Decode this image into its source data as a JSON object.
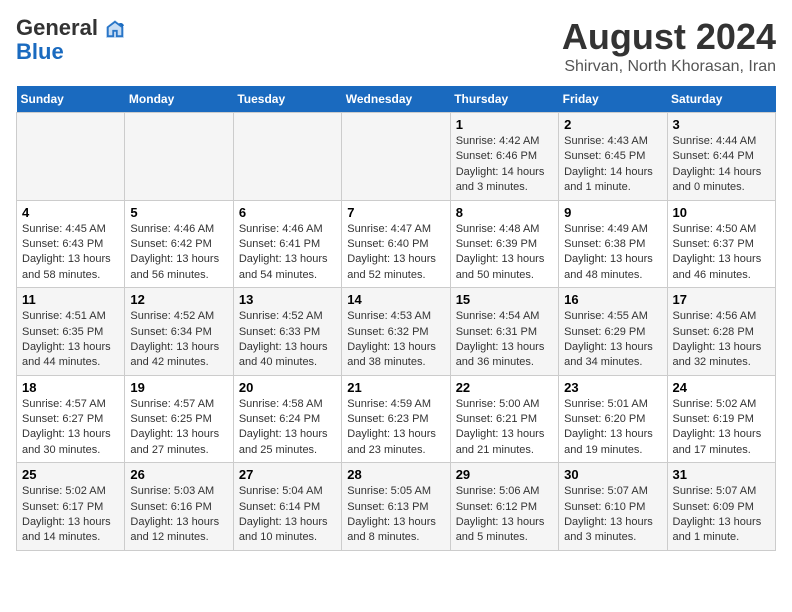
{
  "header": {
    "logo_general": "General",
    "logo_blue": "Blue",
    "main_title": "August 2024",
    "subtitle": "Shirvan, North Khorasan, Iran"
  },
  "weekdays": [
    "Sunday",
    "Monday",
    "Tuesday",
    "Wednesday",
    "Thursday",
    "Friday",
    "Saturday"
  ],
  "weeks": [
    [
      {
        "day": "",
        "info": ""
      },
      {
        "day": "",
        "info": ""
      },
      {
        "day": "",
        "info": ""
      },
      {
        "day": "",
        "info": ""
      },
      {
        "day": "1",
        "info": "Sunrise: 4:42 AM\nSunset: 6:46 PM\nDaylight: 14 hours\nand 3 minutes."
      },
      {
        "day": "2",
        "info": "Sunrise: 4:43 AM\nSunset: 6:45 PM\nDaylight: 14 hours\nand 1 minute."
      },
      {
        "day": "3",
        "info": "Sunrise: 4:44 AM\nSunset: 6:44 PM\nDaylight: 14 hours\nand 0 minutes."
      }
    ],
    [
      {
        "day": "4",
        "info": "Sunrise: 4:45 AM\nSunset: 6:43 PM\nDaylight: 13 hours\nand 58 minutes."
      },
      {
        "day": "5",
        "info": "Sunrise: 4:46 AM\nSunset: 6:42 PM\nDaylight: 13 hours\nand 56 minutes."
      },
      {
        "day": "6",
        "info": "Sunrise: 4:46 AM\nSunset: 6:41 PM\nDaylight: 13 hours\nand 54 minutes."
      },
      {
        "day": "7",
        "info": "Sunrise: 4:47 AM\nSunset: 6:40 PM\nDaylight: 13 hours\nand 52 minutes."
      },
      {
        "day": "8",
        "info": "Sunrise: 4:48 AM\nSunset: 6:39 PM\nDaylight: 13 hours\nand 50 minutes."
      },
      {
        "day": "9",
        "info": "Sunrise: 4:49 AM\nSunset: 6:38 PM\nDaylight: 13 hours\nand 48 minutes."
      },
      {
        "day": "10",
        "info": "Sunrise: 4:50 AM\nSunset: 6:37 PM\nDaylight: 13 hours\nand 46 minutes."
      }
    ],
    [
      {
        "day": "11",
        "info": "Sunrise: 4:51 AM\nSunset: 6:35 PM\nDaylight: 13 hours\nand 44 minutes."
      },
      {
        "day": "12",
        "info": "Sunrise: 4:52 AM\nSunset: 6:34 PM\nDaylight: 13 hours\nand 42 minutes."
      },
      {
        "day": "13",
        "info": "Sunrise: 4:52 AM\nSunset: 6:33 PM\nDaylight: 13 hours\nand 40 minutes."
      },
      {
        "day": "14",
        "info": "Sunrise: 4:53 AM\nSunset: 6:32 PM\nDaylight: 13 hours\nand 38 minutes."
      },
      {
        "day": "15",
        "info": "Sunrise: 4:54 AM\nSunset: 6:31 PM\nDaylight: 13 hours\nand 36 minutes."
      },
      {
        "day": "16",
        "info": "Sunrise: 4:55 AM\nSunset: 6:29 PM\nDaylight: 13 hours\nand 34 minutes."
      },
      {
        "day": "17",
        "info": "Sunrise: 4:56 AM\nSunset: 6:28 PM\nDaylight: 13 hours\nand 32 minutes."
      }
    ],
    [
      {
        "day": "18",
        "info": "Sunrise: 4:57 AM\nSunset: 6:27 PM\nDaylight: 13 hours\nand 30 minutes."
      },
      {
        "day": "19",
        "info": "Sunrise: 4:57 AM\nSunset: 6:25 PM\nDaylight: 13 hours\nand 27 minutes."
      },
      {
        "day": "20",
        "info": "Sunrise: 4:58 AM\nSunset: 6:24 PM\nDaylight: 13 hours\nand 25 minutes."
      },
      {
        "day": "21",
        "info": "Sunrise: 4:59 AM\nSunset: 6:23 PM\nDaylight: 13 hours\nand 23 minutes."
      },
      {
        "day": "22",
        "info": "Sunrise: 5:00 AM\nSunset: 6:21 PM\nDaylight: 13 hours\nand 21 minutes."
      },
      {
        "day": "23",
        "info": "Sunrise: 5:01 AM\nSunset: 6:20 PM\nDaylight: 13 hours\nand 19 minutes."
      },
      {
        "day": "24",
        "info": "Sunrise: 5:02 AM\nSunset: 6:19 PM\nDaylight: 13 hours\nand 17 minutes."
      }
    ],
    [
      {
        "day": "25",
        "info": "Sunrise: 5:02 AM\nSunset: 6:17 PM\nDaylight: 13 hours\nand 14 minutes."
      },
      {
        "day": "26",
        "info": "Sunrise: 5:03 AM\nSunset: 6:16 PM\nDaylight: 13 hours\nand 12 minutes."
      },
      {
        "day": "27",
        "info": "Sunrise: 5:04 AM\nSunset: 6:14 PM\nDaylight: 13 hours\nand 10 minutes."
      },
      {
        "day": "28",
        "info": "Sunrise: 5:05 AM\nSunset: 6:13 PM\nDaylight: 13 hours\nand 8 minutes."
      },
      {
        "day": "29",
        "info": "Sunrise: 5:06 AM\nSunset: 6:12 PM\nDaylight: 13 hours\nand 5 minutes."
      },
      {
        "day": "30",
        "info": "Sunrise: 5:07 AM\nSunset: 6:10 PM\nDaylight: 13 hours\nand 3 minutes."
      },
      {
        "day": "31",
        "info": "Sunrise: 5:07 AM\nSunset: 6:09 PM\nDaylight: 13 hours\nand 1 minute."
      }
    ]
  ]
}
